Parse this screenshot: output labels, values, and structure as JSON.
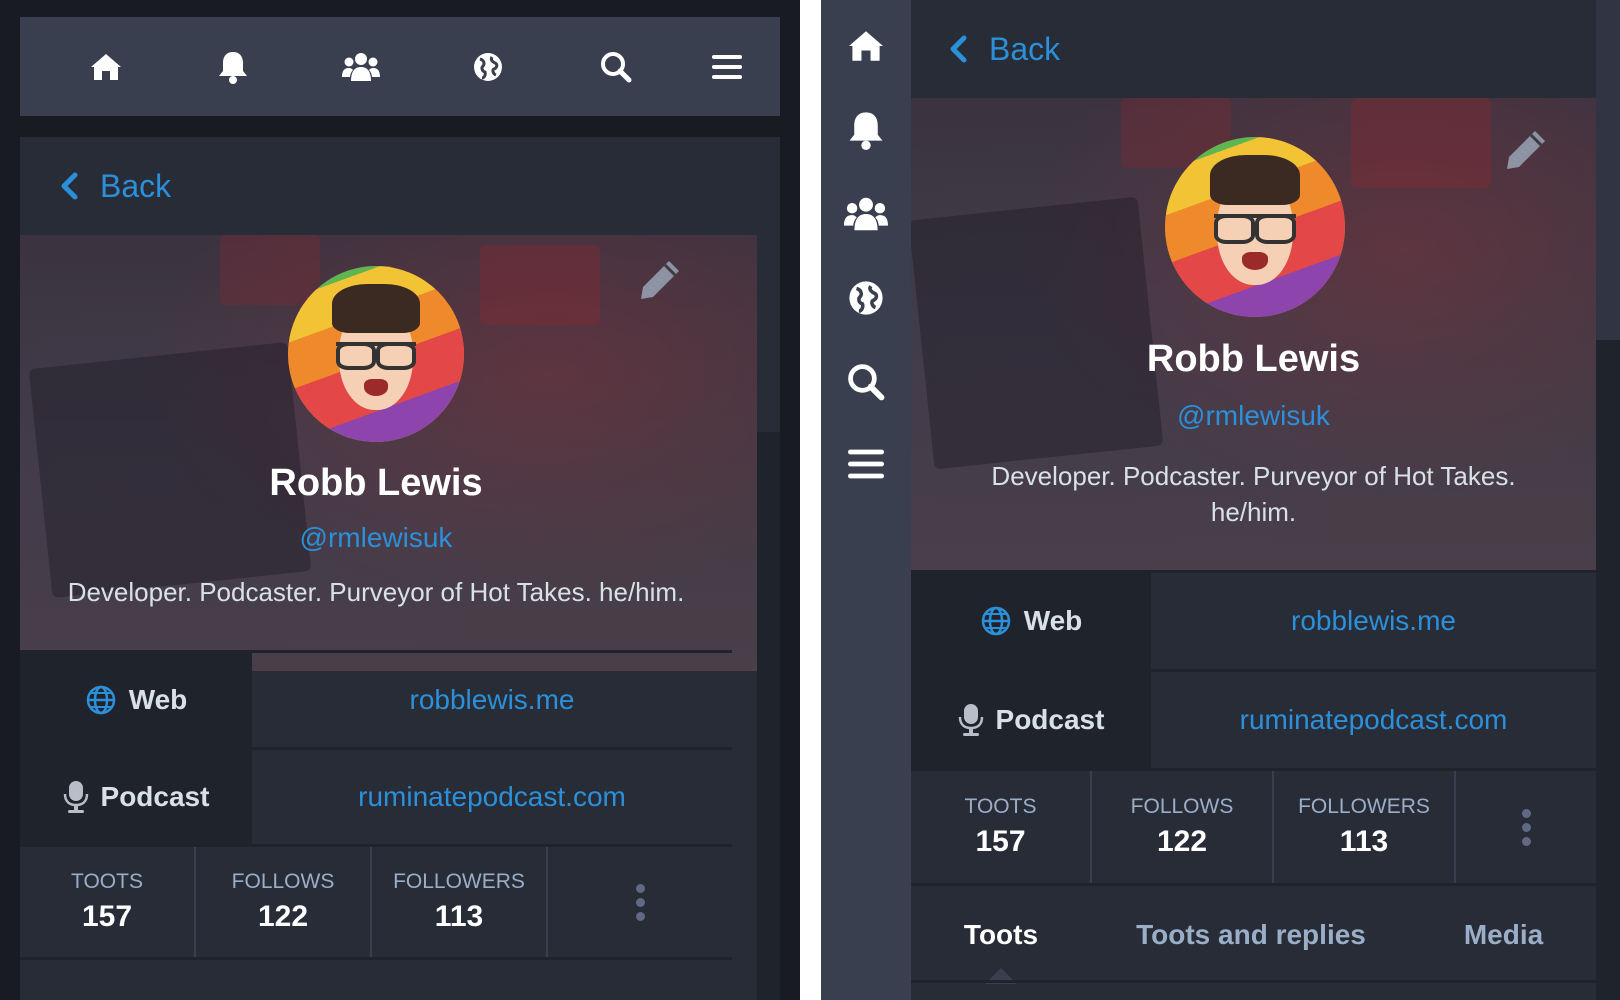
{
  "nav": {
    "home_icon": "home-icon",
    "notifications_icon": "bell-icon",
    "local_icon": "users-icon",
    "federated_icon": "globe-icon",
    "search_icon": "search-icon",
    "menu_icon": "hamburger-menu-icon"
  },
  "back_label": "Back",
  "profile": {
    "display_name": "Robb Lewis",
    "handle": "@rmlewisuk",
    "bio": "Developer. Podcaster. Purveyor of Hot Takes. he/him.",
    "bio_line1": "Developer. Podcaster. Purveyor of Hot Takes.",
    "bio_line2": "he/him."
  },
  "fields": [
    {
      "label": "Web",
      "icon": "globe-icon",
      "value": "robblewis.me"
    },
    {
      "label": "Podcast",
      "icon": "microphone-icon",
      "value": "ruminatepodcast.com"
    }
  ],
  "counts": {
    "toots_label": "TOOTS",
    "toots_value": "157",
    "follows_label": "FOLLOWS",
    "follows_value": "122",
    "followers_label": "FOLLOWERS",
    "followers_value": "113"
  },
  "tabs": [
    {
      "label": "Toots",
      "active": true
    },
    {
      "label": "Toots and replies",
      "active": false
    },
    {
      "label": "Media",
      "active": false
    }
  ],
  "colors": {
    "accent": "#2b90d9",
    "background": "#282c37",
    "nav": "#393f4f",
    "text": "#ffffff",
    "muted": "#9baec8"
  }
}
